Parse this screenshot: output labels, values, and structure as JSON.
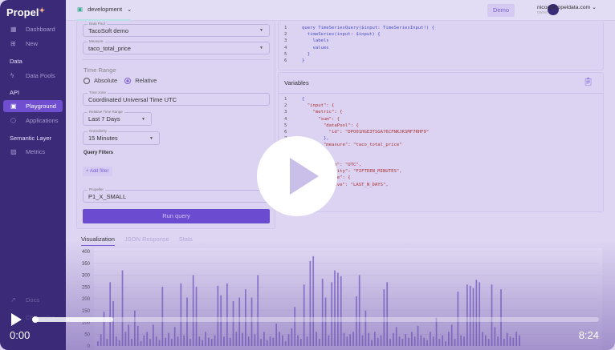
{
  "app": {
    "logo": "Propel"
  },
  "sidebar": {
    "items": [
      {
        "label": "Dashboard",
        "icon": "dashboard-icon"
      },
      {
        "label": "New",
        "icon": "plus-square-icon"
      }
    ],
    "sections": [
      {
        "title": "Data",
        "items": [
          {
            "label": "Data Pools"
          }
        ]
      },
      {
        "title": "API",
        "items": [
          {
            "label": "Playground",
            "active": true
          },
          {
            "label": "Applications"
          }
        ]
      },
      {
        "title": "Semantic Layer",
        "items": [
          {
            "label": "Metrics"
          }
        ]
      }
    ],
    "footer": [
      {
        "label": "Docs"
      },
      {
        "label": "Changelog"
      }
    ]
  },
  "topbar": {
    "environment": "development",
    "demo": "Demo",
    "user_email": "nico@propeldata.com",
    "user_role": "owner"
  },
  "form": {
    "data_pool": {
      "label": "Data Pool",
      "value": "TacoSoft demo"
    },
    "measure": {
      "label": "Measure",
      "value": "taco_total_price"
    },
    "time_range_title": "Time Range",
    "radio_absolute": "Absolute",
    "radio_relative": "Relative",
    "time_zone": {
      "label": "Time zone",
      "value": "Coordinated Universal Time UTC"
    },
    "relative_range": {
      "label": "Relative Time Range",
      "value": "Last 7 Days"
    },
    "granularity": {
      "label": "Granularity",
      "value": "15 Minutes"
    },
    "query_filters": "Query Filters",
    "add_filter": "Add filter",
    "propeller": {
      "label": "Propeller",
      "value": "P1_X_SMALL"
    },
    "run": "Run query"
  },
  "query_lines": [
    "query TimeSeriesQuery($input: TimeSeriesInput!) {",
    "  timeSeries(input: $input) {",
    "    labels",
    "    values",
    "  }",
    "}"
  ],
  "variables": {
    "title": "Variables",
    "lines": [
      "{",
      "  \"input\": {",
      "    \"metric\": {",
      "      \"sum\": {",
      "        \"dataPool\": {",
      "          \"id\": \"DPO01HGE3TSGA76CFNKJKSMF7RHF9\"",
      "        },",
      "        \"measure\": \"taco_total_price\"",
      "      }",
      "    },",
      "    \"timeZone\": \"UTC\",",
      "    \"granularity\": \"FIFTEEN_MINUTES\",",
      "    \"timeRange\": {",
      "      \"relative\": \"LAST_N_DAYS\","
    ]
  },
  "result_tabs": [
    "Visualization",
    "JSON Response",
    "Stats"
  ],
  "video": {
    "current": "0:00",
    "duration": "8:24",
    "progress": 0.14
  },
  "chart_data": {
    "type": "bar",
    "ylim": [
      0,
      400
    ],
    "yticks": [
      0,
      50,
      100,
      150,
      200,
      250,
      300,
      350,
      400
    ],
    "values": [
      20,
      50,
      145,
      30,
      270,
      190,
      40,
      25,
      320,
      60,
      90,
      30,
      150,
      85,
      20,
      45,
      60,
      30,
      90,
      40,
      25,
      250,
      35,
      55,
      30,
      80,
      40,
      265,
      45,
      205,
      30,
      300,
      250,
      40,
      25,
      60,
      35,
      30,
      45,
      255,
      215,
      40,
      265,
      35,
      190,
      60,
      205,
      55,
      240,
      40,
      205,
      50,
      300,
      30,
      60,
      25,
      40,
      35,
      95,
      60,
      45,
      20,
      50,
      75,
      165,
      45,
      30,
      260,
      40,
      360,
      380,
      60,
      30,
      285,
      205,
      45,
      270,
      320,
      310,
      295,
      55,
      40,
      50,
      60,
      210,
      300,
      45,
      150,
      55,
      25,
      60,
      35,
      45,
      240,
      270,
      30,
      55,
      80,
      40,
      30,
      50,
      35,
      60,
      40,
      85,
      45,
      35,
      25,
      60,
      40,
      120,
      30,
      45,
      20,
      60,
      90,
      30,
      230,
      45,
      40,
      260,
      255,
      245,
      280,
      270,
      60,
      45,
      30,
      260,
      80,
      40,
      240,
      30,
      55,
      40,
      35,
      60,
      45
    ]
  }
}
